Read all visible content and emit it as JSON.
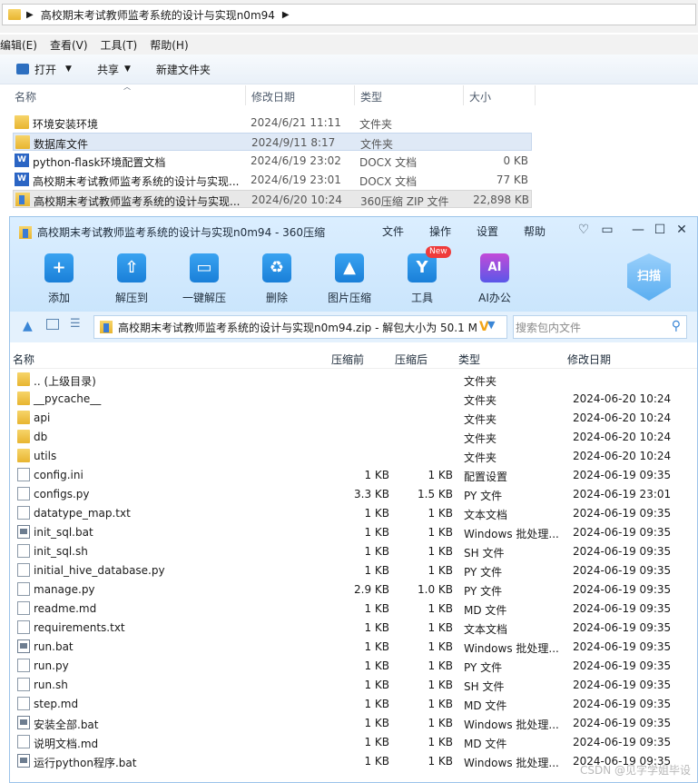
{
  "explorer": {
    "address_path": "高校期末考试教师监考系统的设计与实现n0m94",
    "menu": [
      "编辑(E)",
      "查看(V)",
      "工具(T)",
      "帮助(H)"
    ],
    "toolbar": {
      "open": "打开",
      "share": "共享",
      "new_folder": "新建文件夹"
    },
    "columns": {
      "name": "名称",
      "date": "修改日期",
      "type": "类型",
      "size": "大小"
    },
    "files": [
      {
        "icon": "folder",
        "name": "环境安装环境",
        "date": "2024/6/21 11:11",
        "type": "文件夹",
        "size": ""
      },
      {
        "icon": "folder",
        "name": "数据库文件",
        "date": "2024/9/11 8:17",
        "type": "文件夹",
        "size": ""
      },
      {
        "icon": "word",
        "name": "python-flask环境配置文档",
        "date": "2024/6/19 23:02",
        "type": "DOCX 文档",
        "size": "0 KB"
      },
      {
        "icon": "word",
        "name": "高校期末考试教师监考系统的设计与实现...",
        "date": "2024/6/19 23:01",
        "type": "DOCX 文档",
        "size": "77 KB"
      },
      {
        "icon": "zip",
        "name": "高校期末考试教师监考系统的设计与实现...",
        "date": "2024/6/20 10:24",
        "type": "360压缩 ZIP 文件",
        "size": "22,898 KB"
      }
    ]
  },
  "zip360": {
    "title": "高校期末考试教师监考系统的设计与实现n0m94 - 360压缩",
    "menu": [
      "文件",
      "操作",
      "设置",
      "帮助"
    ],
    "actions": [
      "添加",
      "解压到",
      "一键解压",
      "删除",
      "图片压缩",
      "工具",
      "AI办公"
    ],
    "new_badge": "New",
    "scan_label": "扫描",
    "path_text": "高校期末考试教师监考系统的设计与实现n0m94.zip - 解包大小为 50.1 M",
    "search_placeholder": "搜索包内文件",
    "columns": {
      "name": "名称",
      "before": "压缩前",
      "after": "压缩后",
      "type": "类型",
      "date": "修改日期"
    },
    "rows": [
      {
        "icon": "folder",
        "name": ".. (上级目录)",
        "before": "",
        "after": "",
        "type": "文件夹",
        "date": ""
      },
      {
        "icon": "folder",
        "name": "__pycache__",
        "before": "",
        "after": "",
        "type": "文件夹",
        "date": "2024-06-20 10:24"
      },
      {
        "icon": "folder",
        "name": "api",
        "before": "",
        "after": "",
        "type": "文件夹",
        "date": "2024-06-20 10:24"
      },
      {
        "icon": "folder",
        "name": "db",
        "before": "",
        "after": "",
        "type": "文件夹",
        "date": "2024-06-20 10:24"
      },
      {
        "icon": "folder",
        "name": "utils",
        "before": "",
        "after": "",
        "type": "文件夹",
        "date": "2024-06-20 10:24"
      },
      {
        "icon": "gear",
        "name": "config.ini",
        "before": "1 KB",
        "after": "1 KB",
        "type": "配置设置",
        "date": "2024-06-19 09:35"
      },
      {
        "icon": "doc",
        "name": "configs.py",
        "before": "3.3 KB",
        "after": "1.5 KB",
        "type": "PY 文件",
        "date": "2024-06-19 23:01"
      },
      {
        "icon": "doc",
        "name": "datatype_map.txt",
        "before": "1 KB",
        "after": "1 KB",
        "type": "文本文档",
        "date": "2024-06-19 09:35"
      },
      {
        "icon": "bat",
        "name": "init_sql.bat",
        "before": "1 KB",
        "after": "1 KB",
        "type": "Windows 批处理...",
        "date": "2024-06-19 09:35"
      },
      {
        "icon": "doc",
        "name": "init_sql.sh",
        "before": "1 KB",
        "after": "1 KB",
        "type": "SH 文件",
        "date": "2024-06-19 09:35"
      },
      {
        "icon": "doc",
        "name": "initial_hive_database.py",
        "before": "1 KB",
        "after": "1 KB",
        "type": "PY 文件",
        "date": "2024-06-19 09:35"
      },
      {
        "icon": "doc",
        "name": "manage.py",
        "before": "2.9 KB",
        "after": "1.0 KB",
        "type": "PY 文件",
        "date": "2024-06-19 09:35"
      },
      {
        "icon": "doc",
        "name": "readme.md",
        "before": "1 KB",
        "after": "1 KB",
        "type": "MD 文件",
        "date": "2024-06-19 09:35"
      },
      {
        "icon": "doc",
        "name": "requirements.txt",
        "before": "1 KB",
        "after": "1 KB",
        "type": "文本文档",
        "date": "2024-06-19 09:35"
      },
      {
        "icon": "bat",
        "name": "run.bat",
        "before": "1 KB",
        "after": "1 KB",
        "type": "Windows 批处理...",
        "date": "2024-06-19 09:35"
      },
      {
        "icon": "doc",
        "name": "run.py",
        "before": "1 KB",
        "after": "1 KB",
        "type": "PY 文件",
        "date": "2024-06-19 09:35"
      },
      {
        "icon": "doc",
        "name": "run.sh",
        "before": "1 KB",
        "after": "1 KB",
        "type": "SH 文件",
        "date": "2024-06-19 09:35"
      },
      {
        "icon": "doc",
        "name": "step.md",
        "before": "1 KB",
        "after": "1 KB",
        "type": "MD 文件",
        "date": "2024-06-19 09:35"
      },
      {
        "icon": "bat",
        "name": "安装全部.bat",
        "before": "1 KB",
        "after": "1 KB",
        "type": "Windows 批处理...",
        "date": "2024-06-19 09:35"
      },
      {
        "icon": "doc",
        "name": "说明文档.md",
        "before": "1 KB",
        "after": "1 KB",
        "type": "MD 文件",
        "date": "2024-06-19 09:35"
      },
      {
        "icon": "bat",
        "name": "运行python程序.bat",
        "before": "1 KB",
        "after": "1 KB",
        "type": "Windows 批处理...",
        "date": "2024-06-19 09:35"
      }
    ]
  },
  "watermark": "CSDN @见字学姐毕设"
}
